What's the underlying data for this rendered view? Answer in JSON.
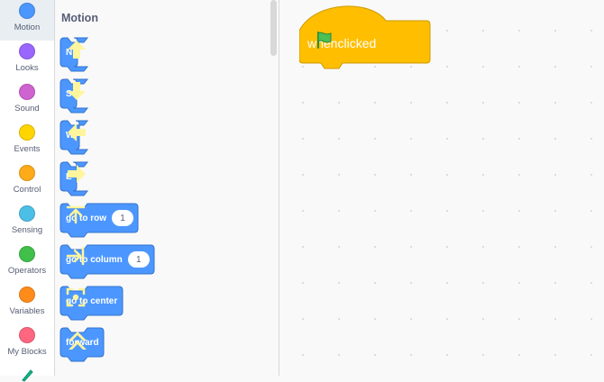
{
  "categories": [
    {
      "label": "Motion",
      "color": "#4c97ff",
      "selected": true
    },
    {
      "label": "Looks",
      "color": "#9966ff"
    },
    {
      "label": "Sound",
      "color": "#cf63cf"
    },
    {
      "label": "Events",
      "color": "#ffd500"
    },
    {
      "label": "Control",
      "color": "#ffab19"
    },
    {
      "label": "Sensing",
      "color": "#4cbfe6"
    },
    {
      "label": "Operators",
      "color": "#40bf4a"
    },
    {
      "label": "Variables",
      "color": "#ff8c1a"
    },
    {
      "label": "My Blocks",
      "color": "#ff6680"
    }
  ],
  "palette": {
    "title": "Motion",
    "blocks": [
      {
        "label": "N",
        "icon": "arrow-up-icon"
      },
      {
        "label": "S",
        "icon": "arrow-down-icon"
      },
      {
        "label": "W",
        "icon": "arrow-left-icon"
      },
      {
        "label": "E",
        "icon": "arrow-right-icon"
      },
      {
        "label": "go to row",
        "input": "1",
        "icon": "go-to-row-icon"
      },
      {
        "label": "go to column",
        "input": "1",
        "icon": "go-to-column-icon"
      },
      {
        "label": "go to center",
        "icon": "center-target-icon"
      },
      {
        "label": "forward",
        "icon": "double-chevron-up-icon"
      }
    ]
  },
  "workspace": {
    "hat_block": {
      "before": "when",
      "icon": "green-flag-icon",
      "after": "clicked"
    }
  },
  "colors": {
    "motion": "#4c97ff",
    "motion_border": "#3373cc",
    "events": "#ffbf00",
    "events_border": "#cc9900",
    "icon_yellow": "#fff59d",
    "flag_green": "#4cbf56"
  }
}
